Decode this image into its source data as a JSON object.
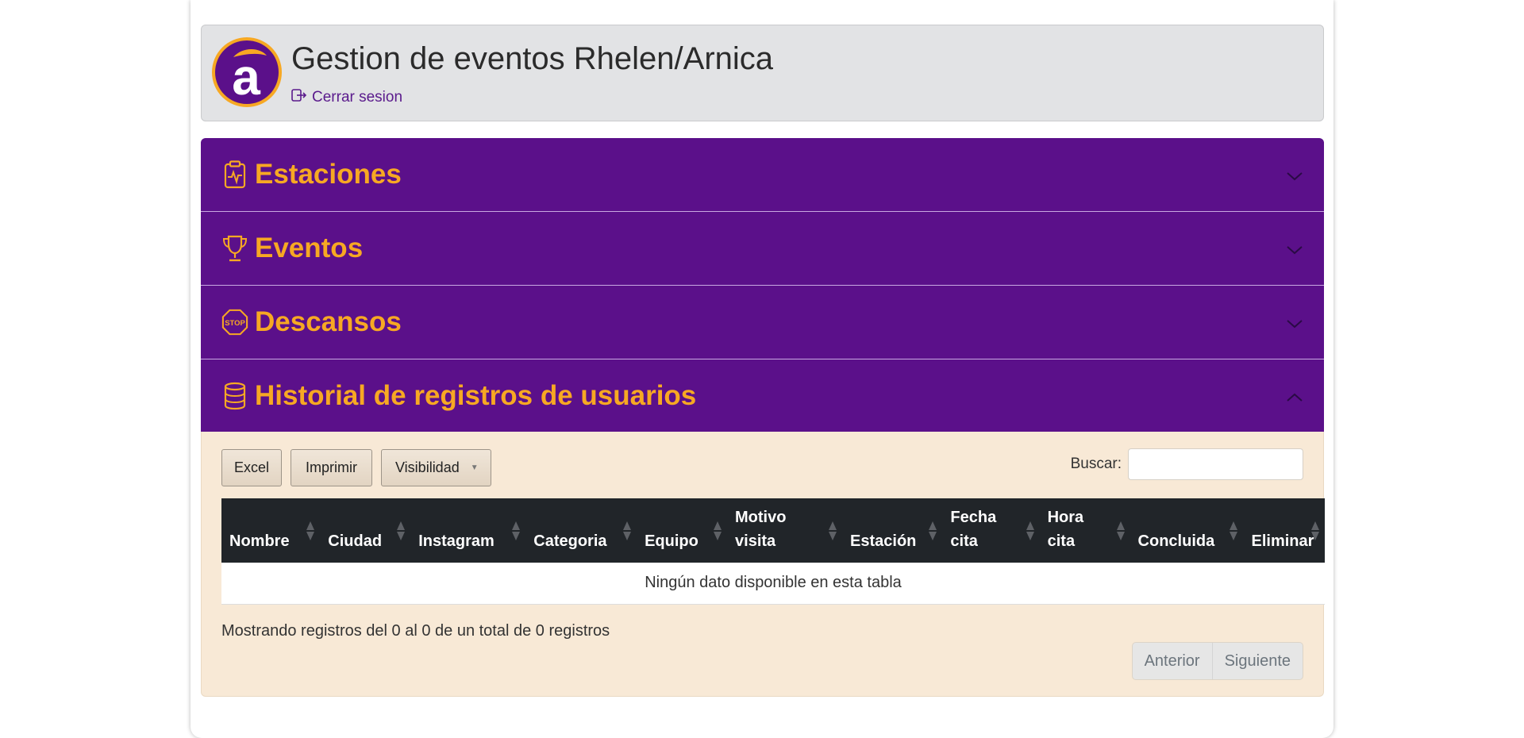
{
  "header": {
    "title": "Gestion de eventos Rhelen/Arnica",
    "logout_label": "Cerrar sesion",
    "logo_letter": "a"
  },
  "colors": {
    "brand_purple": "#5b108a",
    "brand_orange": "#f7a823",
    "panel_beige": "#f8e9d6",
    "table_header": "#212529"
  },
  "accordion": [
    {
      "title": "Estaciones",
      "icon": "clipboard-pulse-icon",
      "expanded": false
    },
    {
      "title": "Eventos",
      "icon": "trophy-icon",
      "expanded": false
    },
    {
      "title": "Descansos",
      "icon": "stop-sign-icon",
      "stop_text": "STOP",
      "expanded": false
    },
    {
      "title": "Historial de registros de usuarios",
      "icon": "database-icon",
      "expanded": true
    }
  ],
  "toolbar": {
    "excel_label": "Excel",
    "print_label": "Imprimir",
    "visibility_label": "Visibilidad",
    "visibility_caret": "▼",
    "search_label": "Buscar:",
    "search_value": ""
  },
  "table": {
    "columns": [
      {
        "line1": "",
        "line2": "Nombre"
      },
      {
        "line1": "",
        "line2": "Ciudad"
      },
      {
        "line1": "",
        "line2": "Instagram"
      },
      {
        "line1": "",
        "line2": "Categoria"
      },
      {
        "line1": "",
        "line2": "Equipo"
      },
      {
        "line1": "Motivo",
        "line2": "visita"
      },
      {
        "line1": "",
        "line2": "Estación"
      },
      {
        "line1": "Fecha",
        "line2": "cita"
      },
      {
        "line1": "Hora",
        "line2": "cita"
      },
      {
        "line1": "",
        "line2": "Concluida"
      },
      {
        "line1": "",
        "line2": "Eliminar"
      }
    ],
    "empty_message": "Ningún dato disponible en esta tabla"
  },
  "footer": {
    "info": "Mostrando registros del 0 al 0 de un total de 0 registros",
    "prev_label": "Anterior",
    "next_label": "Siguiente"
  }
}
